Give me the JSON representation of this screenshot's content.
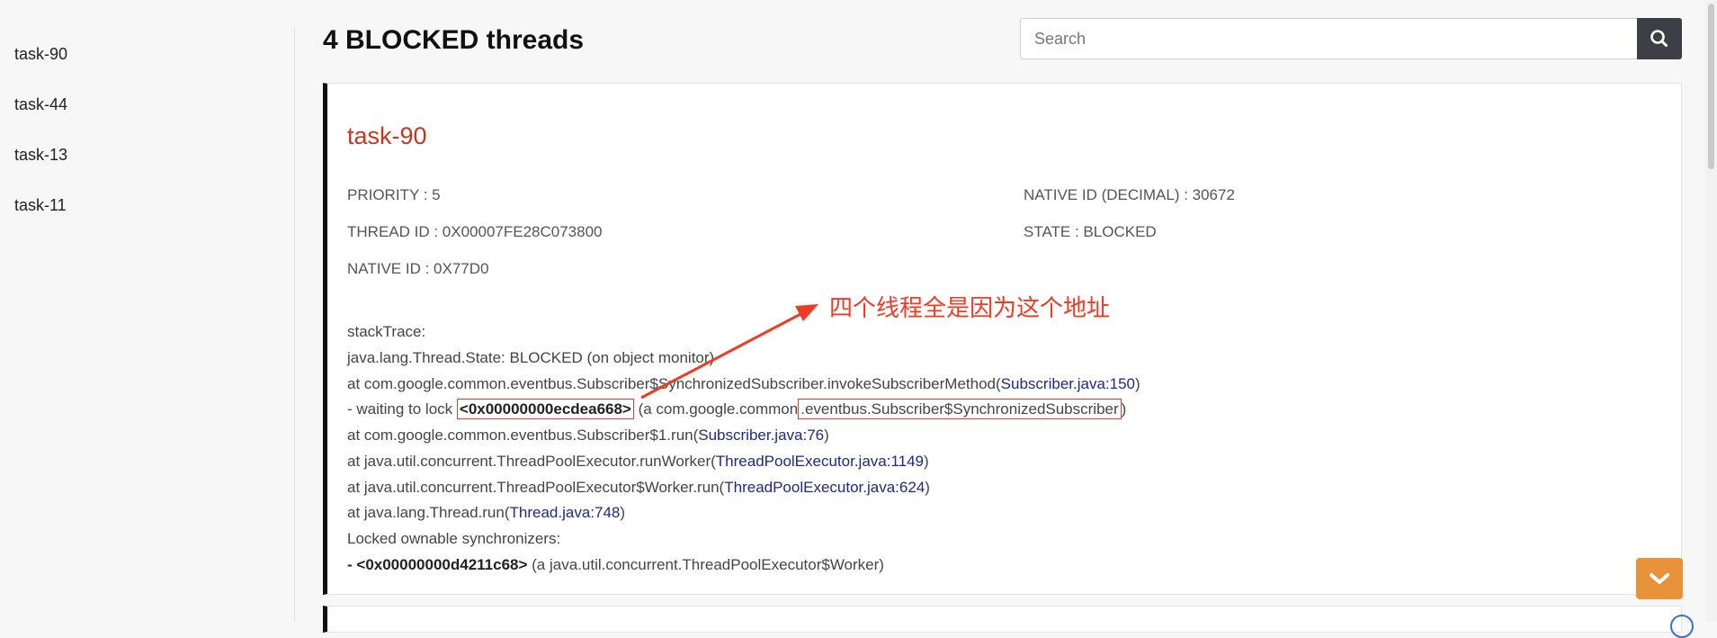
{
  "sidebar": {
    "items": [
      {
        "label": "task-90"
      },
      {
        "label": "task-44"
      },
      {
        "label": "task-13"
      },
      {
        "label": "task-11"
      }
    ]
  },
  "header": {
    "title": "4 BLOCKED threads"
  },
  "search": {
    "placeholder": "Search",
    "value": "",
    "icon": "search-icon"
  },
  "thread": {
    "name": "task-90",
    "priority": "PRIORITY : 5",
    "native_id_decimal": "NATIVE ID (DECIMAL) : 30672",
    "thread_id": "THREAD ID : 0X00007FE28C073800",
    "state": "STATE : BLOCKED",
    "native_id": "NATIVE ID : 0X77D0",
    "stack": {
      "title": "stackTrace:",
      "state_line": "java.lang.Thread.State: BLOCKED (on object monitor)",
      "l1_pre": "at com.google.common.eventbus.Subscriber$SynchronizedSubscriber.invokeSubscriberMethod(",
      "l1_link": "Subscriber.java:150",
      "l1_post": ")",
      "l2_pre": "- waiting to lock ",
      "l2_addr": "<0x00000000ecdea668>",
      "l2_mid": " (a com.google.common",
      "l2_boxed": ".eventbus.Subscriber$SynchronizedSubscriber",
      "l2_post": ")",
      "l3_pre": "at com.google.common.eventbus.Subscriber$1.run(",
      "l3_link": "Subscriber.java:76",
      "l3_post": ")",
      "l4_pre": "at java.util.concurrent.ThreadPoolExecutor.runWorker(",
      "l4_link": "ThreadPoolExecutor.java:1149",
      "l4_post": ")",
      "l5_pre": "at java.util.concurrent.ThreadPoolExecutor$Worker.run(",
      "l5_link": "ThreadPoolExecutor.java:624",
      "l5_post": ")",
      "l6_pre": "at java.lang.Thread.run(",
      "l6_link": "Thread.java:748",
      "l6_post": ")",
      "locked_title": "Locked ownable synchronizers:",
      "l7_pre": "- ",
      "l7_addr": "<0x00000000d4211c68>",
      "l7_post": " (a java.util.concurrent.ThreadPoolExecutor$Worker)"
    }
  },
  "annotation": {
    "text": "四个线程全是因为这个地址",
    "color": "#f03a23"
  },
  "colors": {
    "thread_name": "#c8361e",
    "link": "#1f2a7c",
    "scroll_button": "#e8923a",
    "search_button": "#3e3f46"
  },
  "scroll_button": {
    "icon": "chevron-down-icon"
  }
}
